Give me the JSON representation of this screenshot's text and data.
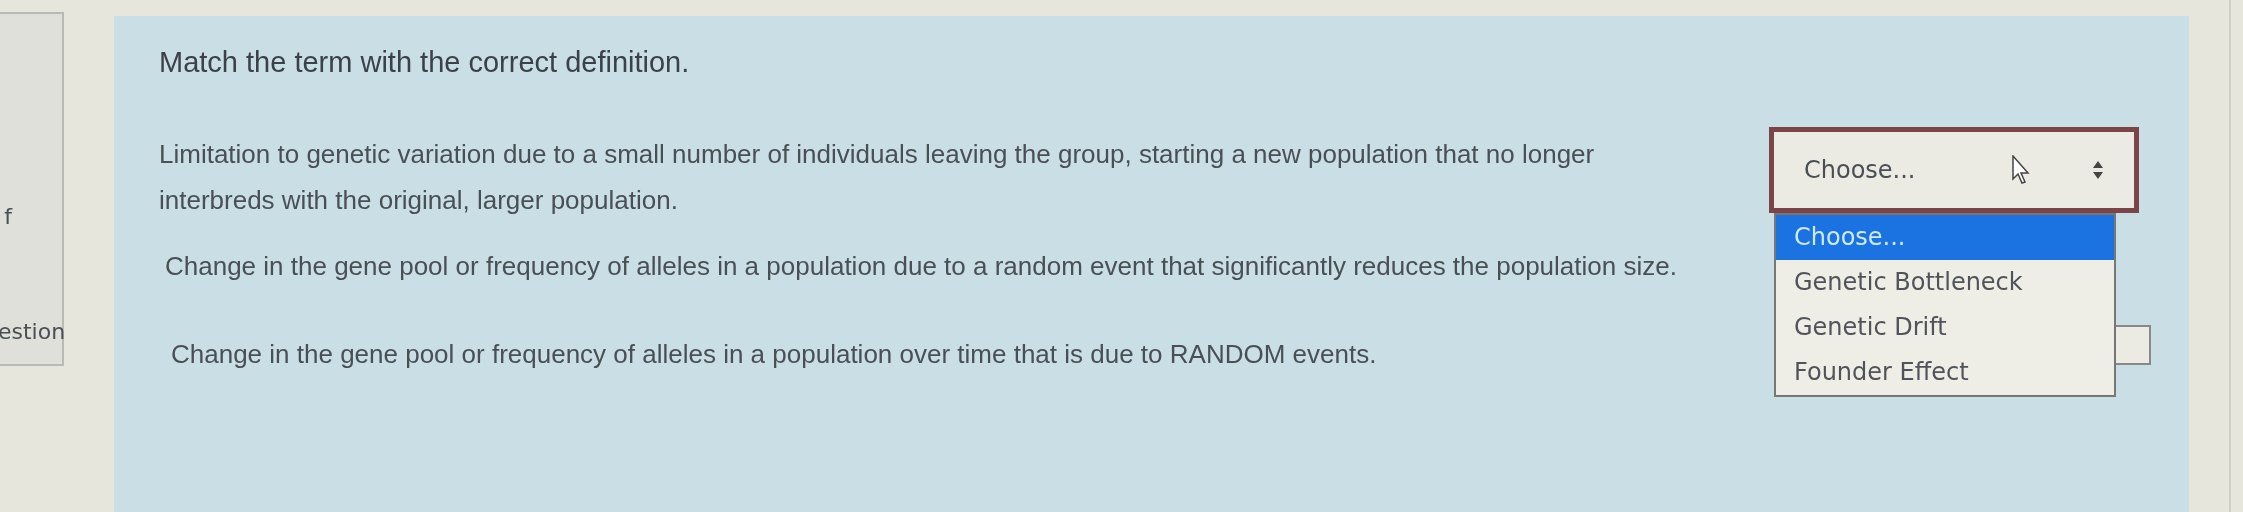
{
  "sidebar": {
    "texts": [
      "f",
      "estion"
    ]
  },
  "question": {
    "prompt": "Match the term with the correct definition.",
    "rows": [
      {
        "definition": "Limitation to genetic variation due to a small number of individuals leaving the group, starting a new population that no longer interbreds with the original, larger population.",
        "select": {
          "value": "Choose..."
        }
      },
      {
        "definition": "Change in the gene pool or frequency of alleles in a population due to a random event that significantly reduces the population size."
      },
      {
        "definition": "Change in the gene pool or frequency of alleles in a population over time that is due to RANDOM events."
      }
    ],
    "options": [
      {
        "label": "Choose...",
        "selected": true
      },
      {
        "label": "Genetic Bottleneck",
        "selected": false
      },
      {
        "label": "Genetic Drift",
        "selected": false
      },
      {
        "label": "Founder Effect",
        "selected": false
      }
    ]
  }
}
